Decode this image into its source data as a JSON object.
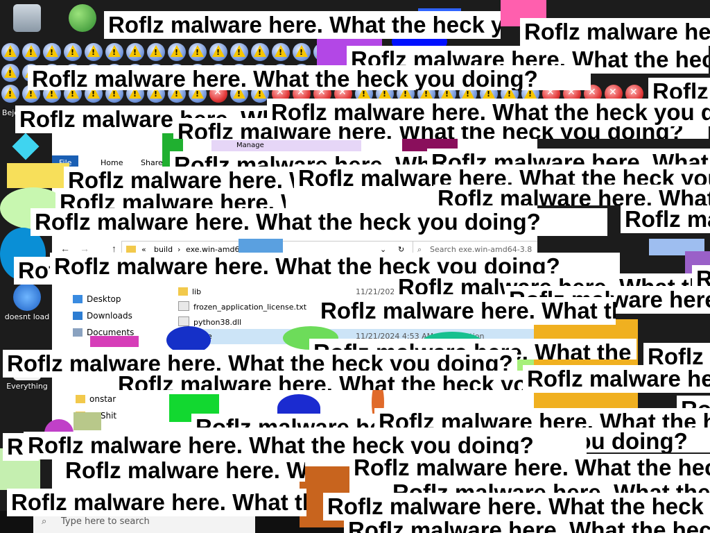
{
  "desktop": {
    "icons": [
      {
        "label": "",
        "icon": "recycle-bin-icon"
      },
      {
        "label": "",
        "icon": "users-shortcut-icon"
      },
      {
        "label": "Beje",
        "icon": "folder-icon"
      },
      {
        "label": "doesnt load",
        "icon": "app-shortcut-icon"
      },
      {
        "label": "Everything",
        "icon": "search-app-icon"
      }
    ]
  },
  "explorer": {
    "ribbon_tabs": [
      "File",
      "Home",
      "Share"
    ],
    "manage_label": "Manage",
    "address_path": [
      "build",
      "exe.win-amd64-3.8"
    ],
    "address_prefix": "«",
    "search_placeholder": "Search exe.win-amd64-3.8",
    "nav_items": [
      {
        "label": "Desktop",
        "icon": "desktop-icon"
      },
      {
        "label": "Downloads",
        "icon": "downloads-icon"
      },
      {
        "label": "Documents",
        "icon": "documents-icon"
      },
      {
        "label": "onstar",
        "icon": "folder-icon"
      },
      {
        "label": "ry Shit",
        "icon": "folder-icon"
      }
    ],
    "files": [
      {
        "name": "lib",
        "date": "11/21/2024",
        "type": "",
        "icon": "folder-icon"
      },
      {
        "name": "frozen_application_license.txt",
        "date": "",
        "type": "",
        "icon": "text-file-icon"
      },
      {
        "name": "python38.dll",
        "date": "",
        "type": "",
        "icon": "dll-file-icon"
      },
      {
        "name": "z.exe",
        "date": "11/21/2024 4:53 AM",
        "type": "Application",
        "icon": "exe-file-icon"
      }
    ]
  },
  "taskbar": {
    "search_placeholder": "Type here to search"
  },
  "malware": {
    "message": "Roflz malware here. What the heck you doing?"
  },
  "colors": {
    "warning_yellow": "#f7c600",
    "error_red": "#e23a3a",
    "popup_bg": "#ffffff",
    "popup_text": "#000000"
  }
}
